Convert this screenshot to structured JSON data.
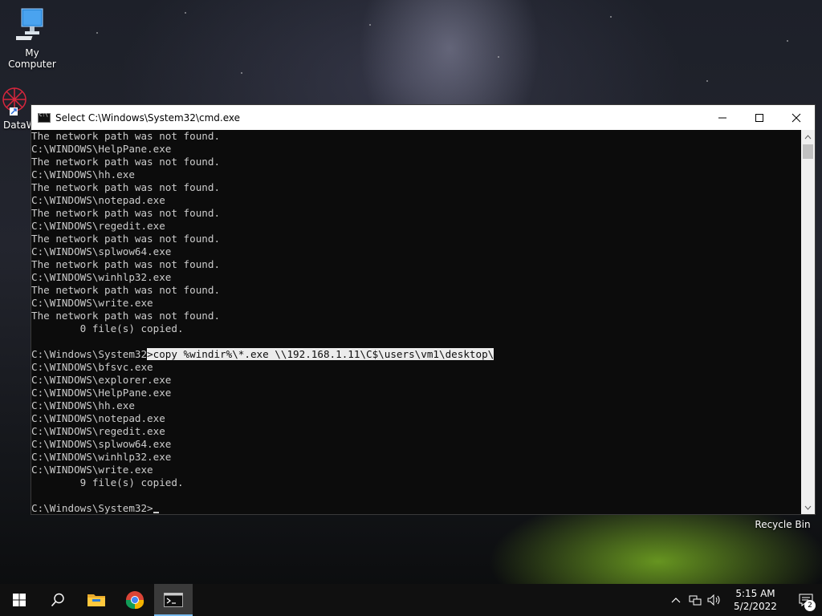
{
  "desktop": {
    "icons": [
      {
        "label": "My Computer",
        "icon": "monitor-icon"
      },
      {
        "label": "DataW",
        "icon": "datawrapper-icon"
      },
      {
        "label": "Recycle Bin",
        "icon": "recycle-bin-icon"
      }
    ]
  },
  "cmd_window": {
    "title": "Select C:\\Windows\\System32\\cmd.exe",
    "controls": {
      "minimize": "minimize-icon",
      "maximize": "maximize-icon",
      "close": "close-icon"
    },
    "lines": [
      "The network path was not found.",
      "C:\\WINDOWS\\HelpPane.exe",
      "The network path was not found.",
      "C:\\WINDOWS\\hh.exe",
      "The network path was not found.",
      "C:\\WINDOWS\\notepad.exe",
      "The network path was not found.",
      "C:\\WINDOWS\\regedit.exe",
      "The network path was not found.",
      "C:\\WINDOWS\\splwow64.exe",
      "The network path was not found.",
      "C:\\WINDOWS\\winhlp32.exe",
      "The network path was not found.",
      "C:\\WINDOWS\\write.exe",
      "The network path was not found.",
      "        0 file(s) copied.",
      ""
    ],
    "command_prompt": "C:\\Windows\\System32",
    "command_selected": ">copy %windir%\\*.exe \\\\192.168.1.11\\C$\\users\\vm1\\desktop\\",
    "output_lines": [
      "C:\\WINDOWS\\bfsvc.exe",
      "C:\\WINDOWS\\explorer.exe",
      "C:\\WINDOWS\\HelpPane.exe",
      "C:\\WINDOWS\\hh.exe",
      "C:\\WINDOWS\\notepad.exe",
      "C:\\WINDOWS\\regedit.exe",
      "C:\\WINDOWS\\splwow64.exe",
      "C:\\WINDOWS\\winhlp32.exe",
      "C:\\WINDOWS\\write.exe",
      "        9 file(s) copied.",
      ""
    ],
    "final_prompt": "C:\\Windows\\System32>"
  },
  "taskbar": {
    "buttons": [
      "start-icon",
      "search-icon",
      "file-explorer-icon",
      "chrome-icon",
      "cmd-icon"
    ],
    "tray_icons": [
      "chevron-up-icon",
      "network-icon",
      "volume-icon"
    ],
    "time": "5:15 AM",
    "date": "5/2/2022",
    "notification_count": "2"
  },
  "colors": {
    "console_bg": "#0c0c0c",
    "console_text": "#cccccc",
    "selection_bg": "#ececec",
    "taskbar_bg": "#101010",
    "active_indicator": "#76b9ed"
  }
}
